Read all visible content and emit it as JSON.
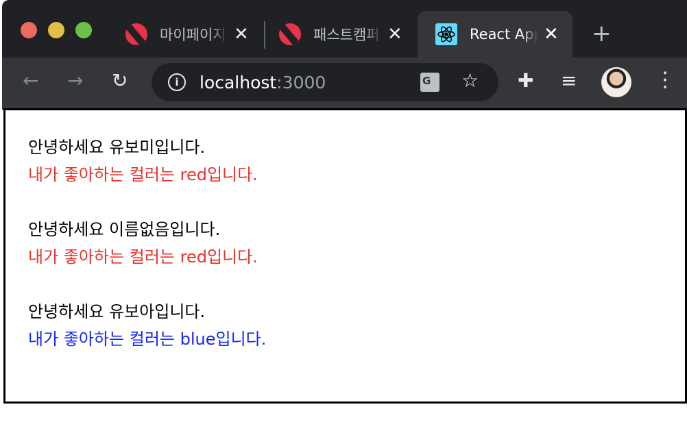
{
  "browser": {
    "tabs": [
      {
        "title": "마이페이지",
        "icon": "fastcampus-logo-icon"
      },
      {
        "title": "패스트캠퍼스",
        "icon": "fastcampus-logo-icon"
      },
      {
        "title": "React App",
        "icon": "react-logo-icon",
        "active": true
      }
    ],
    "url_host": "localhost",
    "url_port": ":3000"
  },
  "greetings": [
    {
      "hello": "안녕하세요 유보미입니다.",
      "color_text": "내가 좋아하는 컬러는 red입니다.",
      "color": "red"
    },
    {
      "hello": "안녕하세요 이름없음입니다.",
      "color_text": "내가 좋아하는 컬러는 red입니다.",
      "color": "red"
    },
    {
      "hello": "안녕하세요 유보아입니다.",
      "color_text": "내가 좋아하는 컬러는 blue입니다.",
      "color": "blue"
    }
  ]
}
